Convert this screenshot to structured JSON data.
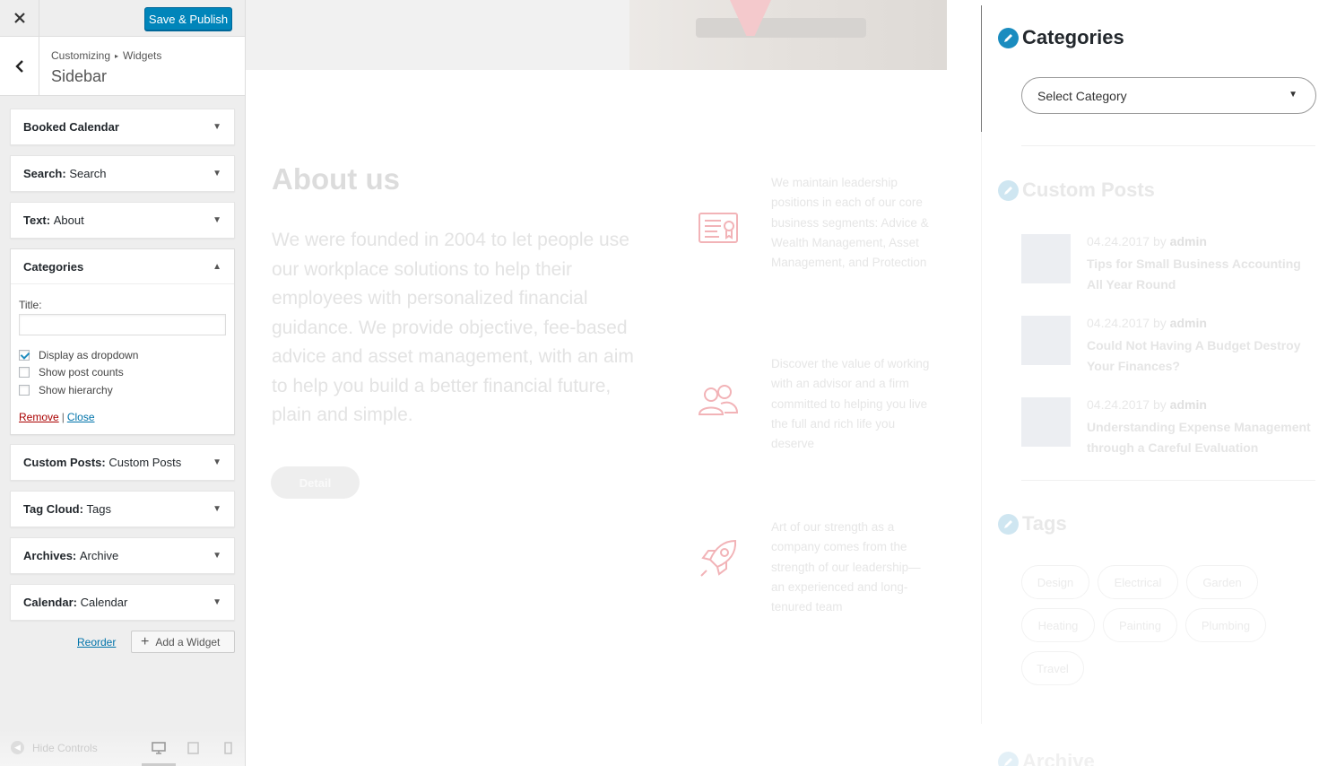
{
  "customizer": {
    "close_label": "×",
    "save_label": "Save & Publish",
    "breadcrumb": [
      "Customizing",
      "Widgets"
    ],
    "breadcrumb_sep": "▸",
    "panel_title": "Sidebar",
    "widgets": [
      {
        "label": "Booked Calendar",
        "sub": "",
        "state": "collapsed"
      },
      {
        "label": "Search:",
        "sub": "Search",
        "state": "collapsed"
      },
      {
        "label": "Text:",
        "sub": "About",
        "state": "collapsed"
      },
      {
        "label": "Categories",
        "sub": "",
        "state": "expanded"
      },
      {
        "label": "Custom Posts:",
        "sub": "Custom Posts",
        "state": "collapsed"
      },
      {
        "label": "Tag Cloud:",
        "sub": "Tags",
        "state": "collapsed"
      },
      {
        "label": "Archives:",
        "sub": "Archive",
        "state": "collapsed"
      },
      {
        "label": "Calendar:",
        "sub": "Calendar",
        "state": "collapsed"
      }
    ],
    "categories_form": {
      "title_label": "Title:",
      "title_value": "",
      "options": [
        {
          "label": "Display as dropdown",
          "checked": true
        },
        {
          "label": "Show post counts",
          "checked": false
        },
        {
          "label": "Show hierarchy",
          "checked": false
        }
      ],
      "remove_label": "Remove",
      "separator": "|",
      "close_label": "Close"
    },
    "reorder_label": "Reorder",
    "add_widget_label": "Add a Widget",
    "hide_controls_label": "Hide Controls",
    "active_device": "desktop"
  },
  "preview": {
    "about_heading": "About us",
    "about_text": "We were founded in 2004 to let people use our workplace solutions to help their employees with personalized financial guidance. We provide objective, fee-based advice and asset management, with an aim to help you build a better financial future, plain and simple.",
    "detail_button": "Detail",
    "features": [
      {
        "icon": "certificate-icon",
        "text": "We maintain leadership positions in each of our core business segments: Advice & Wealth Management, Asset Management, and Protection"
      },
      {
        "icon": "users-icon",
        "text": "Discover the value of working with an advisor and a firm committed to helping you live the full and rich life you deserve"
      },
      {
        "icon": "rocket-icon",
        "text": "Art of our strength as a company comes from the strength of our leadership—an experienced and long-tenured team"
      }
    ],
    "sidebar": {
      "categories_title": "Categories",
      "select_placeholder": "Select Category",
      "custom_posts_title": "Custom Posts",
      "posts": [
        {
          "date": "04.24.2017",
          "by": "by",
          "author": "admin",
          "title": "Tips for Small Business Accounting All Year Round"
        },
        {
          "date": "04.24.2017",
          "by": "by",
          "author": "admin",
          "title": "Could Not Having A Budget Destroy Your Finances?"
        },
        {
          "date": "04.24.2017",
          "by": "by",
          "author": "admin",
          "title": "Understanding Expense Management through a Careful Evaluation"
        }
      ],
      "tags_title": "Tags",
      "tags": [
        "Design",
        "Electrical",
        "Garden",
        "Heating",
        "Painting",
        "Plumbing",
        "Travel"
      ],
      "archive_title": "Archive"
    },
    "colors": {
      "accent": "#0085ba",
      "pencil_active": "#1a8cbf",
      "pencil_faded": "#cfe6f1",
      "feature_icon": "#f2b3b7"
    }
  }
}
